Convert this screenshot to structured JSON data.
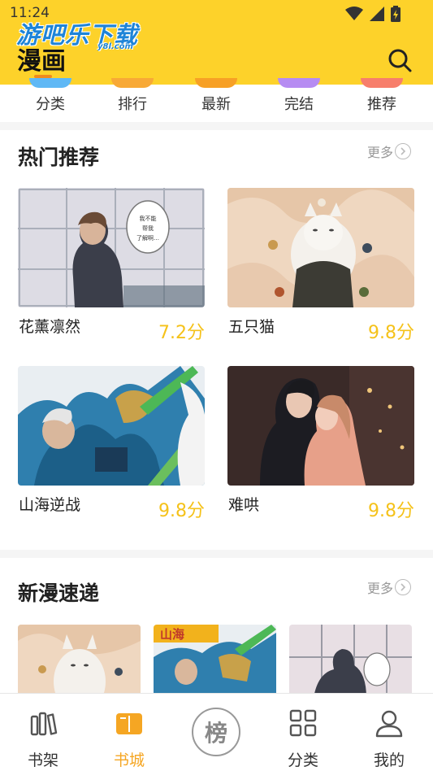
{
  "status_bar": {
    "time": "11:24"
  },
  "watermark": {
    "text": "游吧乐下载",
    "sub": "y8l.com"
  },
  "header": {
    "title": "漫画"
  },
  "categories": [
    {
      "label": "分类",
      "color": "#5fb8f5"
    },
    {
      "label": "排行",
      "color": "#f8a936"
    },
    {
      "label": "最新",
      "color": "#f7a025"
    },
    {
      "label": "完结",
      "color": "#b68cf2"
    },
    {
      "label": "推荐",
      "color": "#f77e6b"
    }
  ],
  "hot": {
    "title": "热门推荐",
    "more": "更多",
    "items": [
      {
        "name": "花薰凛然",
        "score": "7.2分",
        "bubble": "我不能\n帮我\n了解啊…"
      },
      {
        "name": "五只猫",
        "score": "9.8分"
      },
      {
        "name": "山海逆战",
        "score": "9.8分"
      },
      {
        "name": "难哄",
        "score": "9.8分"
      }
    ]
  },
  "new": {
    "title": "新漫速递",
    "more": "更多"
  },
  "bottom_nav": {
    "items": [
      {
        "label": "书架",
        "icon": "bookshelf-icon"
      },
      {
        "label": "书城",
        "icon": "book-open-icon"
      },
      {
        "label": "",
        "icon": "rank-icon"
      },
      {
        "label": "分类",
        "icon": "grid-icon"
      },
      {
        "label": "我的",
        "icon": "user-icon"
      }
    ],
    "rank_char": "榜",
    "active_color": "#f5a623"
  },
  "colors": {
    "brand_yellow": "#fdd22a",
    "score": "#f5c21a",
    "accent_orange": "#f08a1c"
  }
}
